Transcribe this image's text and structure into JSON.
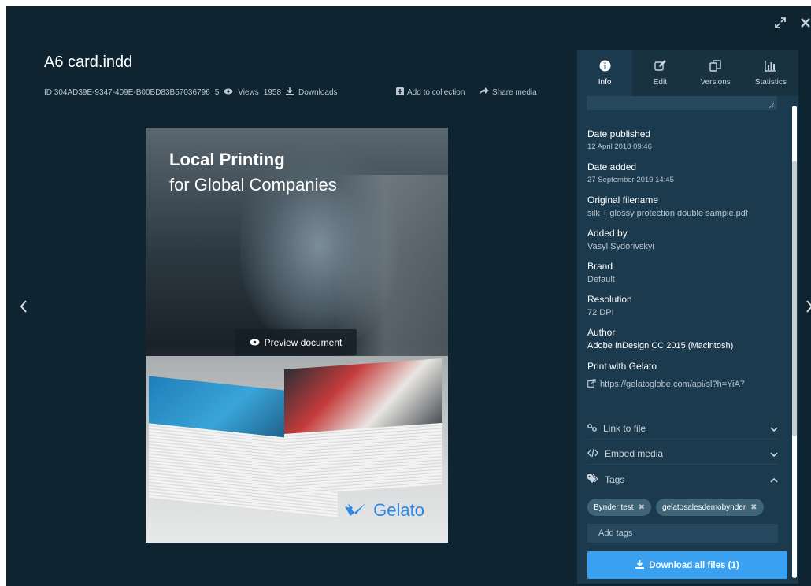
{
  "window": {
    "expand_icon": "expand-arrows-icon",
    "close_icon": "close-x-icon"
  },
  "asset": {
    "title": "A6 card.indd",
    "id_text": "ID 304AD39E-9347-409E-B00BD83B57036796",
    "views_count": "5",
    "views_label": "Views",
    "downloads_count": "1958",
    "downloads_label": "Downloads",
    "add_to_collection": "Add to collection",
    "share_media": "Share media"
  },
  "preview": {
    "headline": "Local Printing",
    "subline": "for Global Companies",
    "brand": "Gelato",
    "button_label": "Preview document"
  },
  "panel": {
    "tabs": [
      {
        "label": "Info",
        "icon": "info-circle-icon"
      },
      {
        "label": "Edit",
        "icon": "edit-pencil-icon"
      },
      {
        "label": "Versions",
        "icon": "versions-copy-icon"
      },
      {
        "label": "Statistics",
        "icon": "bar-chart-icon"
      }
    ],
    "fields": [
      {
        "label": "Date published",
        "value": "12 April 2018 09:46"
      },
      {
        "label": "Date added",
        "value": "27 September 2019 14:45"
      },
      {
        "label": "Original filename",
        "value": "silk + glossy protection double sample.pdf"
      },
      {
        "label": "Added by",
        "value": "Vasyl Sydorivskyi"
      },
      {
        "label": "Brand",
        "value": "Default"
      },
      {
        "label": "Resolution",
        "value": "72 DPI"
      },
      {
        "label": "Author",
        "value": "Adobe InDesign CC 2015 (Macintosh)"
      },
      {
        "label": "Print with Gelato",
        "value": "https://gelatoglobe.com/api/sl?h=YiA7"
      }
    ],
    "sections": [
      {
        "label": "Link to file",
        "icon": "link-icon"
      },
      {
        "label": "Embed media",
        "icon": "code-icon"
      },
      {
        "label": "Tags",
        "icon": "tags-icon"
      }
    ],
    "tags": [
      "Bynder test",
      "gelatosalesdemobynder"
    ],
    "tags_placeholder": "Add tags",
    "download_button": "Download all files (1)"
  }
}
